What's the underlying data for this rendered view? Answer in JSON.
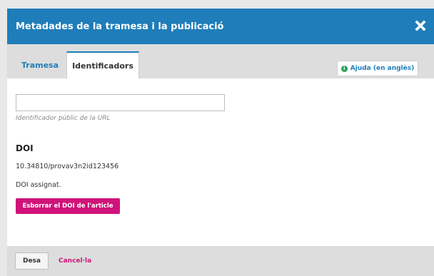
{
  "modal": {
    "title": "Metadades de la tramesa i la publicació",
    "close_icon": "close-icon"
  },
  "tabs": [
    {
      "label": "Tramesa",
      "active": false
    },
    {
      "label": "Identificadors",
      "active": true
    }
  ],
  "help": {
    "icon": "info-icon",
    "label": "Ajuda (en anglès)"
  },
  "url_field": {
    "value": "",
    "description": "Identificador públic de la URL"
  },
  "doi": {
    "section_title": "DOI",
    "value": "10.34810/provav3n2id123456",
    "status": "DOI assignat.",
    "delete_label": "Esborrar el DOI de l'article"
  },
  "footer": {
    "save_label": "Desa",
    "cancel_label": "Cancel·la"
  },
  "colors": {
    "header": "#1f7db9",
    "accent_pink": "#d0137a",
    "info_green": "#26a05a"
  }
}
